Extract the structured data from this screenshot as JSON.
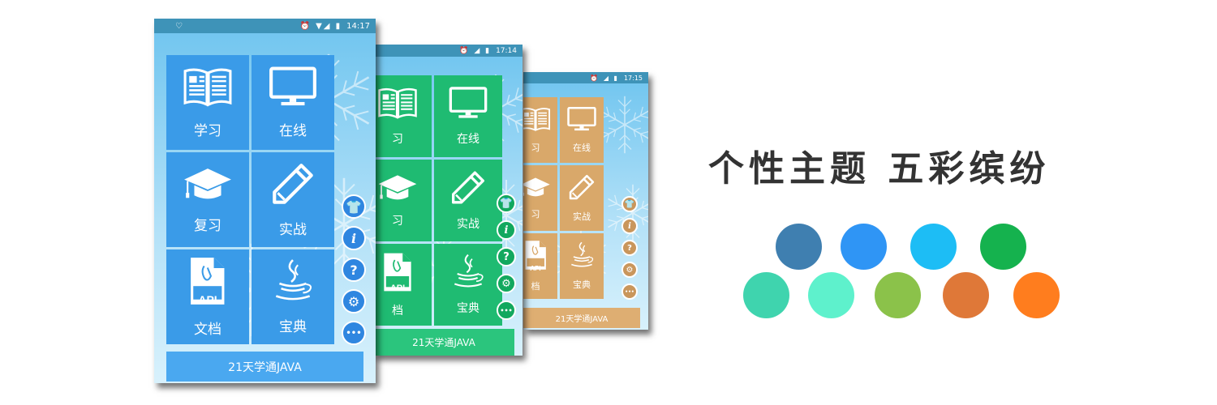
{
  "phones": [
    {
      "id": "blue",
      "time": "14:17",
      "status_icons": "⏰ ▼◢ ▮",
      "status_left": "♡",
      "tile_color": "#3a9be8",
      "bar_color": "#4aa8f0",
      "fab_color": "#2f86e0",
      "tiles": [
        {
          "label": "学习",
          "icon": "book-icon"
        },
        {
          "label": "在线",
          "icon": "monitor-icon"
        },
        {
          "label": "复习",
          "icon": "graduation-cap-icon"
        },
        {
          "label": "实战",
          "icon": "pencil-icon"
        },
        {
          "label": "文档",
          "icon": "api-document-icon"
        },
        {
          "label": "宝典",
          "icon": "java-cup-icon"
        }
      ],
      "api_text": "API",
      "bottom_label": "21天学通JAVA",
      "fabs": [
        {
          "name": "theme-shirt-icon",
          "glyph": "👕"
        },
        {
          "name": "info-icon",
          "glyph": "i"
        },
        {
          "name": "help-icon",
          "glyph": "?"
        },
        {
          "name": "settings-gear-icon",
          "glyph": "⚙"
        },
        {
          "name": "more-icon",
          "glyph": "•••"
        }
      ]
    },
    {
      "id": "green",
      "time": "17:14",
      "status_icons": "⏰ ◢ ▮",
      "tile_color": "#1fbb72",
      "bar_color": "#2bc57d",
      "fab_color": "#12a85e",
      "tiles": [
        {
          "label": "习",
          "icon": "book-icon"
        },
        {
          "label": "在线",
          "icon": "monitor-icon"
        },
        {
          "label": "习",
          "icon": "graduation-cap-icon"
        },
        {
          "label": "实战",
          "icon": "pencil-icon"
        },
        {
          "label": "档",
          "icon": "api-document-icon"
        },
        {
          "label": "宝典",
          "icon": "java-cup-icon"
        }
      ],
      "api_text": "API",
      "bottom_label": "21天学通JAVA",
      "fabs": [
        {
          "name": "theme-shirt-icon",
          "glyph": "👕"
        },
        {
          "name": "info-icon",
          "glyph": "i"
        },
        {
          "name": "help-icon",
          "glyph": "?"
        },
        {
          "name": "settings-gear-icon",
          "glyph": "⚙"
        },
        {
          "name": "more-icon",
          "glyph": "•••"
        }
      ]
    },
    {
      "id": "orange",
      "time": "17:15",
      "status_icons": "⏰ ◢ ▮",
      "tile_color": "#d9a86a",
      "bar_color": "#deae72",
      "fab_color": "#c9965c",
      "tiles": [
        {
          "label": "习",
          "icon": "book-icon"
        },
        {
          "label": "在线",
          "icon": "monitor-icon"
        },
        {
          "label": "习",
          "icon": "graduation-cap-icon"
        },
        {
          "label": "实战",
          "icon": "pencil-icon"
        },
        {
          "label": "档",
          "icon": "api-document-icon"
        },
        {
          "label": "宝典",
          "icon": "java-cup-icon"
        }
      ],
      "api_text": "API",
      "bottom_label": "21天学通JAVA",
      "fabs": [
        {
          "name": "theme-shirt-icon",
          "glyph": "👕"
        },
        {
          "name": "info-icon",
          "glyph": "i"
        },
        {
          "name": "help-icon",
          "glyph": "?"
        },
        {
          "name": "settings-gear-icon",
          "glyph": "⚙"
        },
        {
          "name": "more-icon",
          "glyph": "•••"
        }
      ]
    }
  ],
  "headline": "个性主题 五彩缤纷",
  "theme_colors": [
    "#3f7fb0",
    "#2f95f5",
    "#1dbdf5",
    "#15b24e",
    "#3fd4ae",
    "#5ef1cc",
    "#8bc24a",
    "#df7838",
    "#ff7d1e"
  ]
}
